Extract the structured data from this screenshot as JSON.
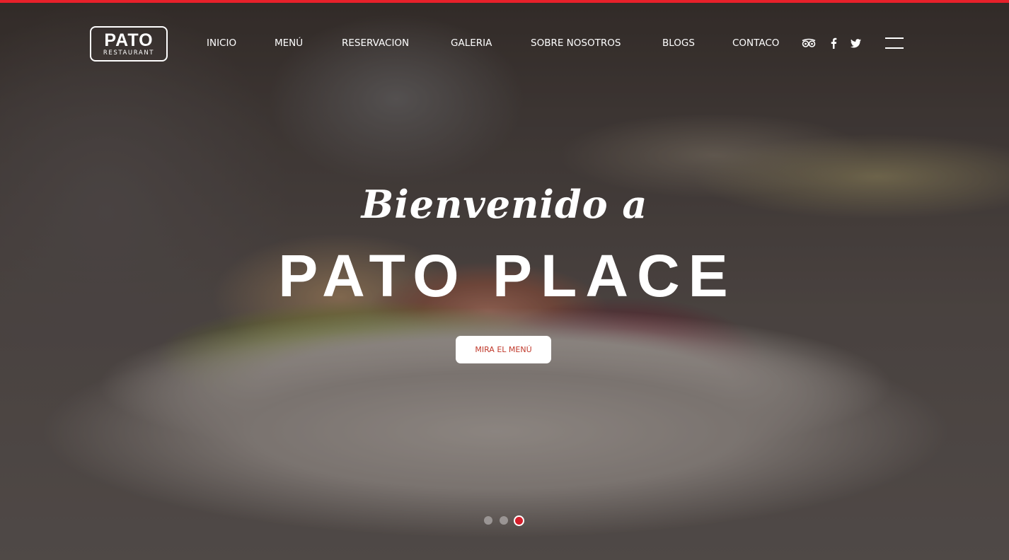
{
  "header": {
    "logo": {
      "title": "PATO",
      "subtitle": "RESTAURANT"
    },
    "nav": [
      {
        "label": "INICIO"
      },
      {
        "label": "MENÚ"
      },
      {
        "label": "RESERVACION"
      },
      {
        "label": "GALERIA"
      },
      {
        "label": "SOBRE NOSOTROS"
      },
      {
        "label": "BLOGS"
      },
      {
        "label": "CONTACO"
      }
    ],
    "social": [
      {
        "icon": "tripadvisor-icon"
      },
      {
        "icon": "facebook-icon"
      },
      {
        "icon": "twitter-icon"
      }
    ],
    "menu_icon": "hamburger-menu-icon"
  },
  "hero": {
    "greeting": "Bienvenido a",
    "headline": "PATO PLACE",
    "cta_label": "MIRA EL MENÚ"
  },
  "slider": {
    "total": 3,
    "active_index": 3
  },
  "colors": {
    "accent": "#e8202a",
    "cta_text": "#c0392b",
    "active_dot": "#d41e2b",
    "text": "#ffffff"
  }
}
